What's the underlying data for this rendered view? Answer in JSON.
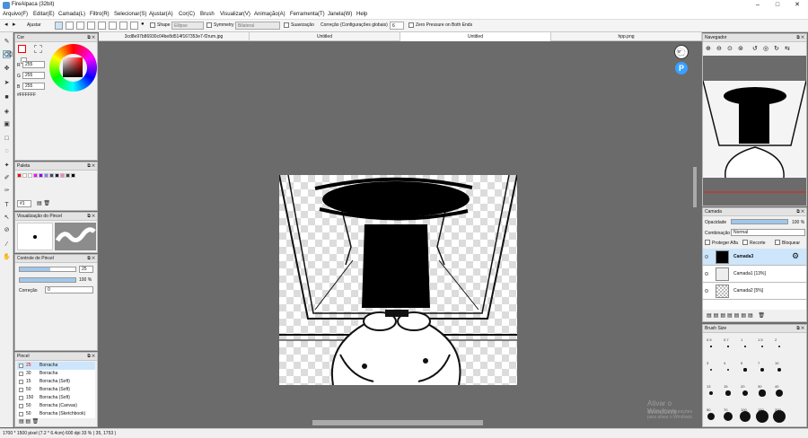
{
  "app": {
    "title": "FireAlpaca (32bit)"
  },
  "menu": [
    "Arquivo(F)",
    "Editar(E)",
    "Camada(L)",
    "Filtro(R)",
    "Selecionar(S)",
    "Ajustar(A)",
    "Cor(C)",
    "Brush",
    "Visualizar(V)",
    "Animação(A)",
    "Ferramenta(T)",
    "Janela(W)",
    "Help"
  ],
  "toolbar": {
    "ajustar": "Ajustar",
    "shape": "Shape",
    "shape_value": "Ellipse",
    "symmetry": "Symmetry",
    "symmetry_value": "Bilateral",
    "suavizacao": "Suavização",
    "correcao": "Correção (Configurações globais)",
    "correcao_value": "6",
    "zero_pressure": "Zero Pressure on Both Ends"
  },
  "color_panel": {
    "title": "Cor",
    "r_label": "R",
    "g_label": "G",
    "b_label": "B",
    "r": "255",
    "g": "255",
    "b": "255",
    "hex": "#FFFFFF"
  },
  "palette_panel": {
    "title": "Paleta",
    "selector": "#1",
    "colors": [
      "#ff0000",
      "#ffffff",
      "#ffffff",
      "#ff00ff",
      "#8000ff",
      "#8080ff",
      "#404080",
      "#202020",
      "#ff80c0",
      "#404040",
      "#000000"
    ]
  },
  "brush_preview": {
    "title": "Visualização do Pincel"
  },
  "brush_control": {
    "title": "Controle de Pincel",
    "size": "25",
    "opacity": "100 %",
    "correction_label": "Correção",
    "correction_value": "0",
    "size_fraction": 0.55,
    "opacity_fraction": 1.0
  },
  "brush_panel": {
    "title": "Pincel",
    "items": [
      {
        "size": "25",
        "name": "Borracha"
      },
      {
        "size": "30",
        "name": "Borracha"
      },
      {
        "size": "15",
        "name": "Borracha (Soft)"
      },
      {
        "size": "50",
        "name": "Borracha (Soft)"
      },
      {
        "size": "150",
        "name": "Borracha (Soft)"
      },
      {
        "size": "50",
        "name": "Borracha (Canvas)"
      },
      {
        "size": "50",
        "name": "Borracha (Sketchbook)"
      }
    ]
  },
  "tabs": [
    {
      "label": "3cd8e97b86930c04be8d514f167353e7-f2rum.jpg"
    },
    {
      "label": "Untitled"
    },
    {
      "label": "Untitled"
    },
    {
      "label": "hpp.png"
    }
  ],
  "navigator": {
    "title": "Navegador"
  },
  "layer_panel": {
    "title": "Camada",
    "opacity_label": "Opacidade",
    "opacity_value": "100 %",
    "blend_label": "Combinação",
    "blend_value": "Normal",
    "protect_alpha": "Proteger Alfa",
    "clipping": "Recorte",
    "lock": "Bloquear",
    "opacity_fraction": 1.0,
    "layers": [
      {
        "name": "Camada3"
      },
      {
        "name": "Camada1 [13%]"
      },
      {
        "name": "Camada2 [5%]"
      }
    ]
  },
  "brush_size": {
    "title": "Brush Size",
    "sizes": [
      "0.5",
      "0.7",
      "1",
      "1.5",
      "2",
      "3",
      "4",
      "5",
      "7",
      "10",
      "13",
      "15",
      "20",
      "30",
      "40",
      "50",
      "70",
      "100",
      "150",
      "200"
    ]
  },
  "watermark": {
    "line1": "Ativar o Windows",
    "line2": "Acesse Configurações para ativar o Windows."
  },
  "status": "1700 * 1500 pixel  (7.2 * 6.4cm)  600 dpi  33 %  ( 35, 1753 )"
}
